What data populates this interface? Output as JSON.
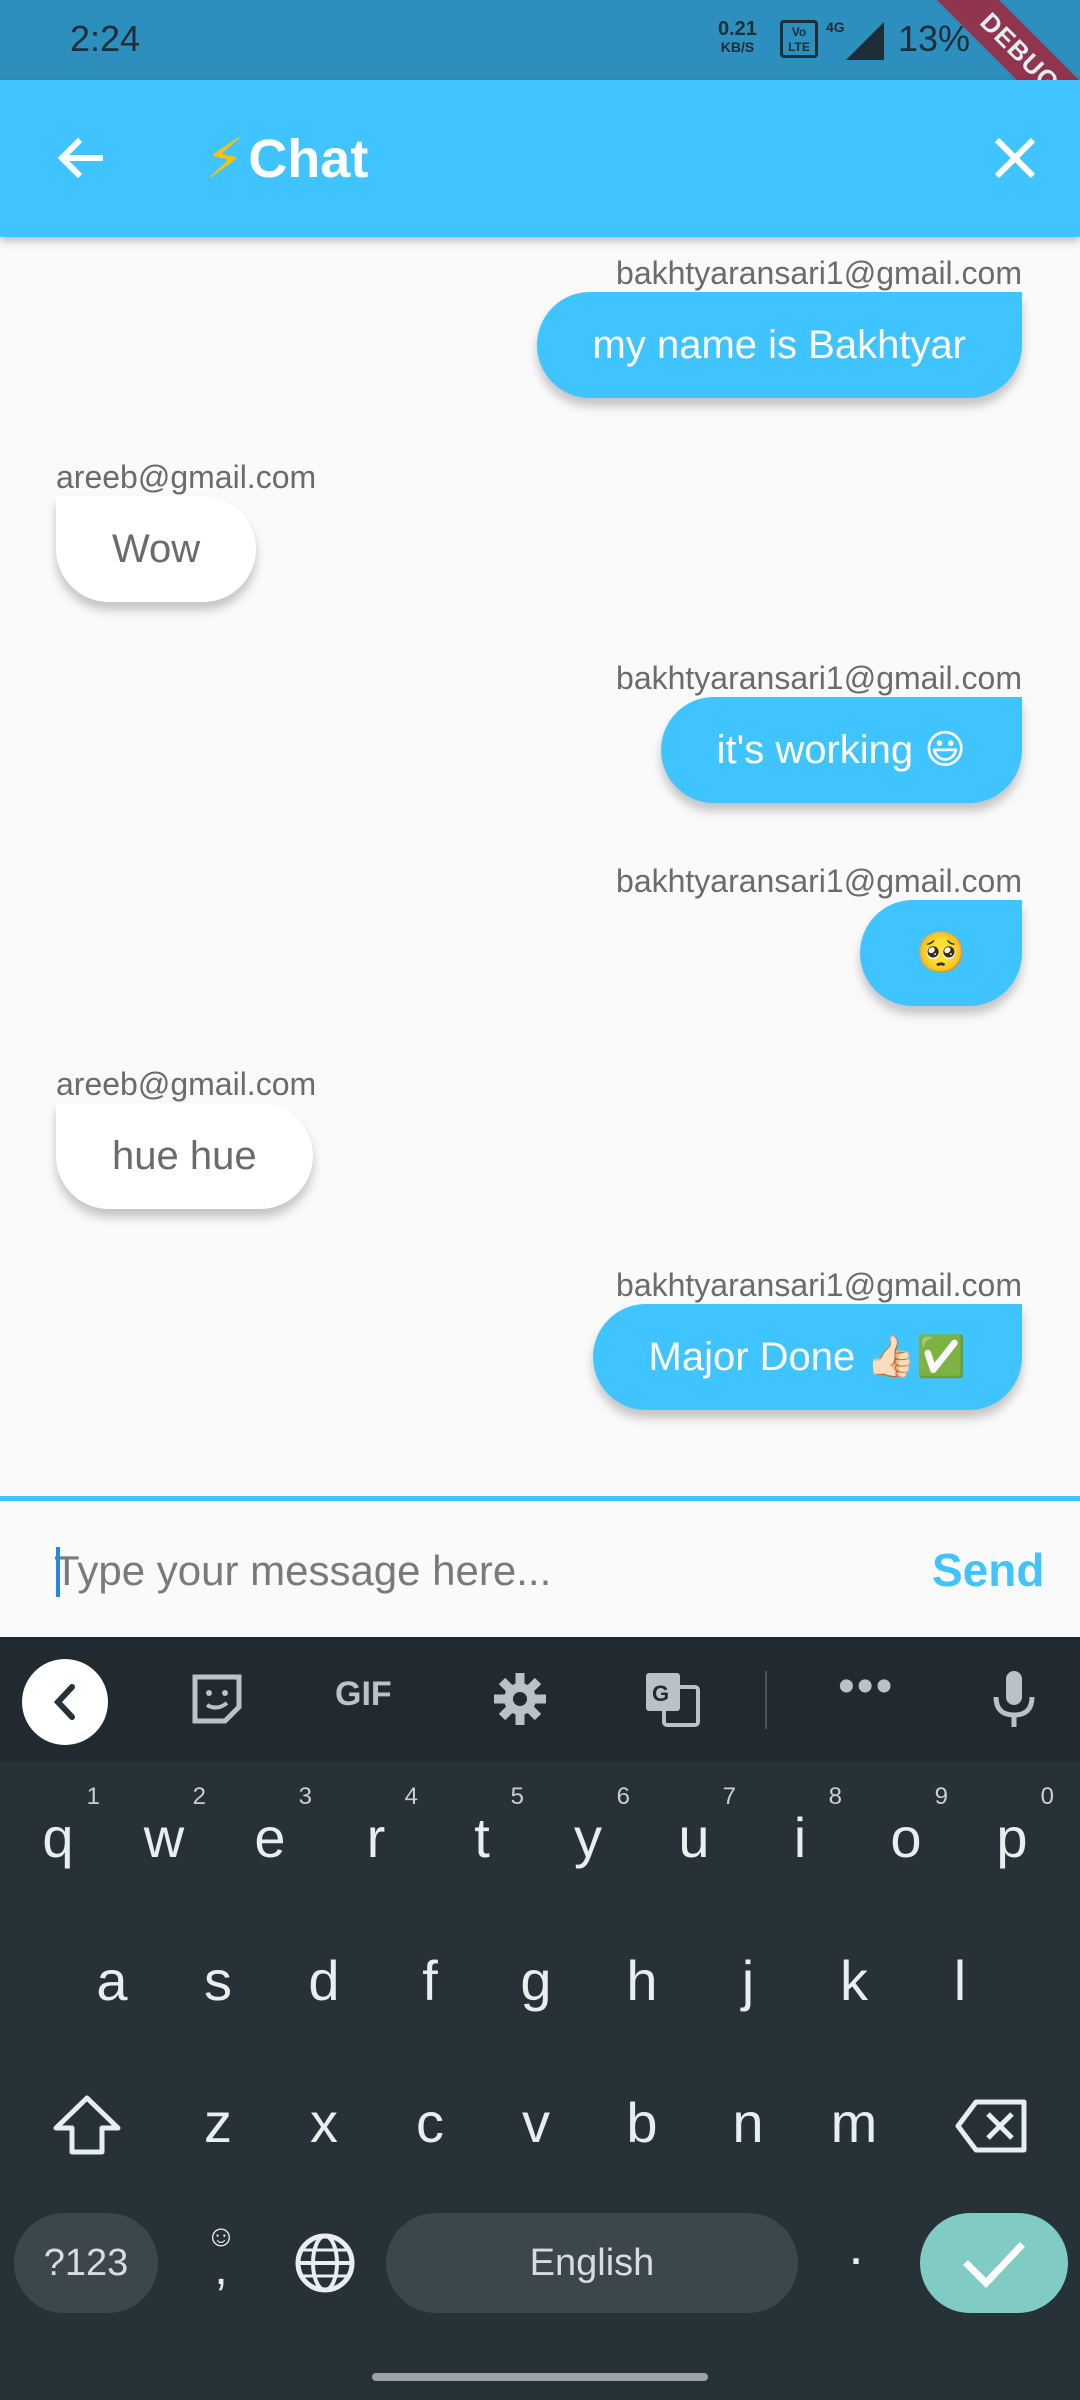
{
  "status_bar": {
    "time": "2:24",
    "network_rate_value": "0.21",
    "network_rate_unit": "KB/S",
    "volte": "VoLTE",
    "network_type": "4G",
    "battery": "13%",
    "debug_banner": "DEBUG"
  },
  "app_bar": {
    "title": "Chat",
    "title_icon": "lightning-bolt"
  },
  "messages": [
    {
      "sender": "bakhtyaransari1@gmail.com",
      "text": "my name is Bakhtyar",
      "is_me": true
    },
    {
      "sender": "areeb@gmail.com",
      "text": "Wow",
      "is_me": false
    },
    {
      "sender": "bakhtyaransari1@gmail.com",
      "text": "it's working 😃",
      "is_me": true
    },
    {
      "sender": "bakhtyaransari1@gmail.com",
      "text": "🥺",
      "is_me": true
    },
    {
      "sender": "areeb@gmail.com",
      "text": "hue hue",
      "is_me": false
    },
    {
      "sender": "bakhtyaransari1@gmail.com",
      "text": "Major Done 👍🏻✅",
      "is_me": true
    }
  ],
  "composer": {
    "placeholder": "Type your message here...",
    "send_label": "Send"
  },
  "keyboard": {
    "toolbar": {
      "gif_label": "GIF"
    },
    "row1": [
      {
        "key": "q",
        "hint": "1"
      },
      {
        "key": "w",
        "hint": "2"
      },
      {
        "key": "e",
        "hint": "3"
      },
      {
        "key": "r",
        "hint": "4"
      },
      {
        "key": "t",
        "hint": "5"
      },
      {
        "key": "y",
        "hint": "6"
      },
      {
        "key": "u",
        "hint": "7"
      },
      {
        "key": "i",
        "hint": "8"
      },
      {
        "key": "o",
        "hint": "9"
      },
      {
        "key": "p",
        "hint": "0"
      }
    ],
    "row2": [
      "a",
      "s",
      "d",
      "f",
      "g",
      "h",
      "j",
      "k",
      "l"
    ],
    "row3": [
      "z",
      "x",
      "c",
      "v",
      "b",
      "n",
      "m"
    ],
    "symbols_label": "?123",
    "emoji_comma": ",",
    "space_label": "English",
    "period": "."
  },
  "colors": {
    "accent": "#40c4ff",
    "status_bar": "#2c8fbd",
    "keyboard_bg": "#263238",
    "enter_key": "#80cbc4",
    "debug_ribbon": "#a3253b"
  }
}
